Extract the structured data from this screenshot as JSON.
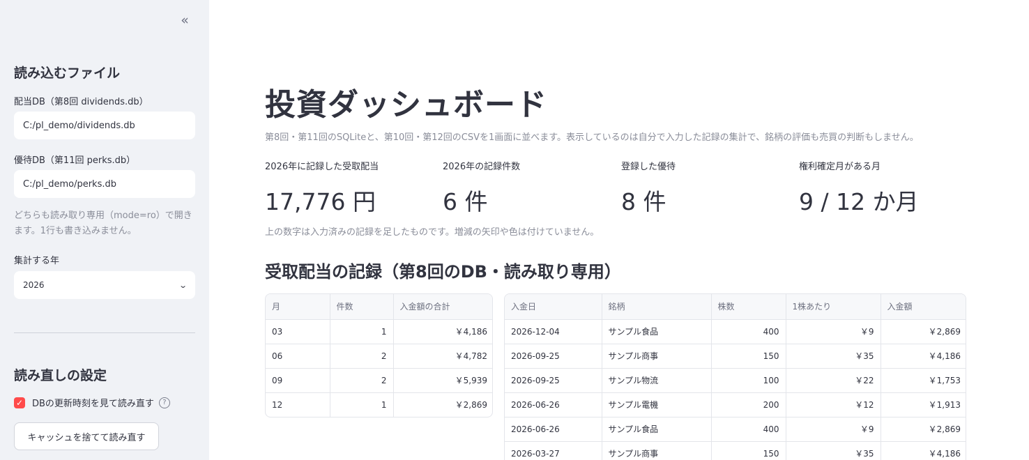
{
  "sidebar": {
    "collapse_icon": "«",
    "files_heading": "読み込むファイル",
    "dividend_db_label": "配当DB（第8回 dividends.db）",
    "dividend_db_value": "C:/pl_demo/dividends.db",
    "perks_db_label": "優待DB（第11回 perks.db）",
    "perks_db_value": "C:/pl_demo/perks.db",
    "readonly_note": "どちらも読み取り専用（mode=ro）で開きます。1行も書き込みません。",
    "year_label": "集計する年",
    "year_value": "2026",
    "reload_heading": "読み直しの設定",
    "check_label": "DBの更新時刻を見て読み直す",
    "check_checked": true,
    "cache_button": "キャッシュを捨てて読み直す"
  },
  "main": {
    "title": "投資ダッシュボード",
    "caption": "第8回・第11回のSQLiteと、第10回・第12回のCSVを1画面に並べます。表示しているのは自分で入力した記録の集計で、銘柄の評価も売買の判断もしません。",
    "metrics": [
      {
        "label": "2026年に記録した受取配当",
        "value": "17,776 円"
      },
      {
        "label": "2026年の記録件数",
        "value": "6 件"
      },
      {
        "label": "登録した優待",
        "value": "8 件"
      },
      {
        "label": "権利確定月がある月",
        "value": "9 / 12 か月"
      }
    ],
    "metrics_note": "上の数字は入力済みの記録を足したものです。増減の矢印や色は付けていません。",
    "section_title": "受取配当の記録（第8回のDB・読み取り専用）",
    "monthly_table": {
      "columns": [
        "月",
        "件数",
        "入金額の合計"
      ],
      "rows": [
        [
          "03",
          "1",
          "￥4,186"
        ],
        [
          "06",
          "2",
          "￥4,782"
        ],
        [
          "09",
          "2",
          "￥5,939"
        ],
        [
          "12",
          "1",
          "￥2,869"
        ]
      ]
    },
    "records_table": {
      "columns": [
        "入金日",
        "銘柄",
        "株数",
        "1株あたり",
        "入金額"
      ],
      "rows": [
        [
          "2026-12-04",
          "サンプル食品",
          "400",
          "￥9",
          "￥2,869"
        ],
        [
          "2026-09-25",
          "サンプル商事",
          "150",
          "￥35",
          "￥4,186"
        ],
        [
          "2026-09-25",
          "サンプル物流",
          "100",
          "￥22",
          "￥1,753"
        ],
        [
          "2026-06-26",
          "サンプル電機",
          "200",
          "￥12",
          "￥1,913"
        ],
        [
          "2026-06-26",
          "サンプル食品",
          "400",
          "￥9",
          "￥2,869"
        ],
        [
          "2026-03-27",
          "サンプル商事",
          "150",
          "￥35",
          "￥4,186"
        ]
      ]
    }
  },
  "colors": {
    "sidebar_bg": "#f0f2f6",
    "accent": "#ff4b4b",
    "text": "#31333f",
    "muted": "#8a8d99"
  }
}
